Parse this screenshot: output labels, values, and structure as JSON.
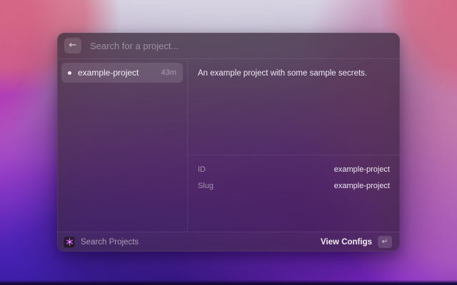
{
  "window": {
    "app": "launcher-command-palette"
  },
  "search": {
    "placeholder": "Search for a project...",
    "back_icon": "←"
  },
  "list": {
    "items": [
      {
        "label": "example-project",
        "accessory": "43m",
        "selected": true
      }
    ]
  },
  "detail": {
    "description": "An example project with some sample secrets.",
    "metadata": [
      {
        "label": "ID",
        "value": "example-project"
      },
      {
        "label": "Slug",
        "value": "example-project"
      }
    ]
  },
  "footer": {
    "command_name": "Search Projects",
    "primary_action": "View Configs",
    "enter_key": "↵"
  },
  "colors": {
    "extension_icon_glyph": "#c24fe0",
    "panel_tint": "#3e2f3e",
    "selection": "rgba(255,255,255,0.11)"
  }
}
